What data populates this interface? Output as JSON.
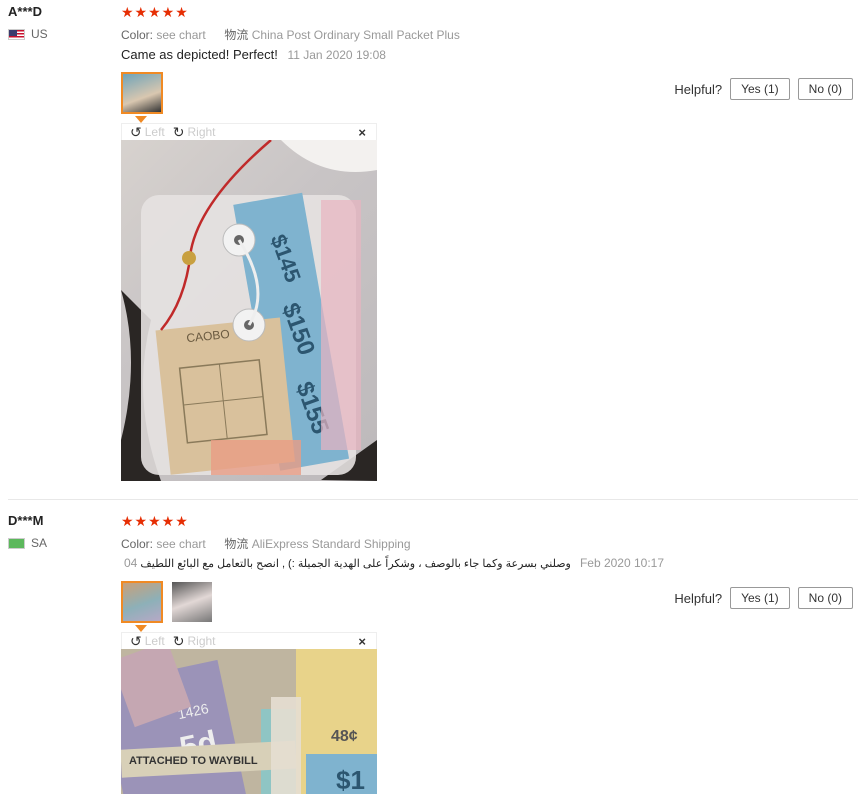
{
  "reviews": [
    {
      "user": "A***D",
      "country": "US",
      "stars": "★★★★★",
      "color_label": "Color:",
      "color_value": "see chart",
      "shipping_label": "物流",
      "shipping_value": "China Post Ordinary Small Packet Plus",
      "feedback": "Came as depicted! Perfect!",
      "date": "11 Jan 2020 19:08",
      "helpful_label": "Helpful?",
      "yes_label": "Yes (1)",
      "no_label": "No (0)",
      "viewer": {
        "left_label": "Left",
        "right_label": "Right",
        "close": "×"
      },
      "ticket_labels": [
        "$145",
        "$150",
        "$155",
        "CAOBO"
      ]
    },
    {
      "user": "D***M",
      "country": "SA",
      "stars": "★★★★★",
      "color_label": "Color:",
      "color_value": "see chart",
      "shipping_label": "物流",
      "shipping_value": "AliExpress Standard Shipping",
      "feedback": "وصلني بسرعة وكما جاء بالوصف ، وشكراً على الهدية الجميلة :) , انصح بالتعامل مع البائع اللطيف",
      "date_prefix": "04",
      "date": "Feb 2020 10:17",
      "helpful_label": "Helpful?",
      "yes_label": "Yes (1)",
      "no_label": "No (0)",
      "viewer": {
        "left_label": "Left",
        "right_label": "Right",
        "close": "×"
      },
      "ticket_labels": [
        "ATTACHED TO WAYBILL",
        "48¢",
        "$1",
        "5d",
        "1426"
      ]
    }
  ],
  "colors": {
    "star": "#e62e04",
    "active_thumb": "#f08a24",
    "muted": "#999999"
  }
}
